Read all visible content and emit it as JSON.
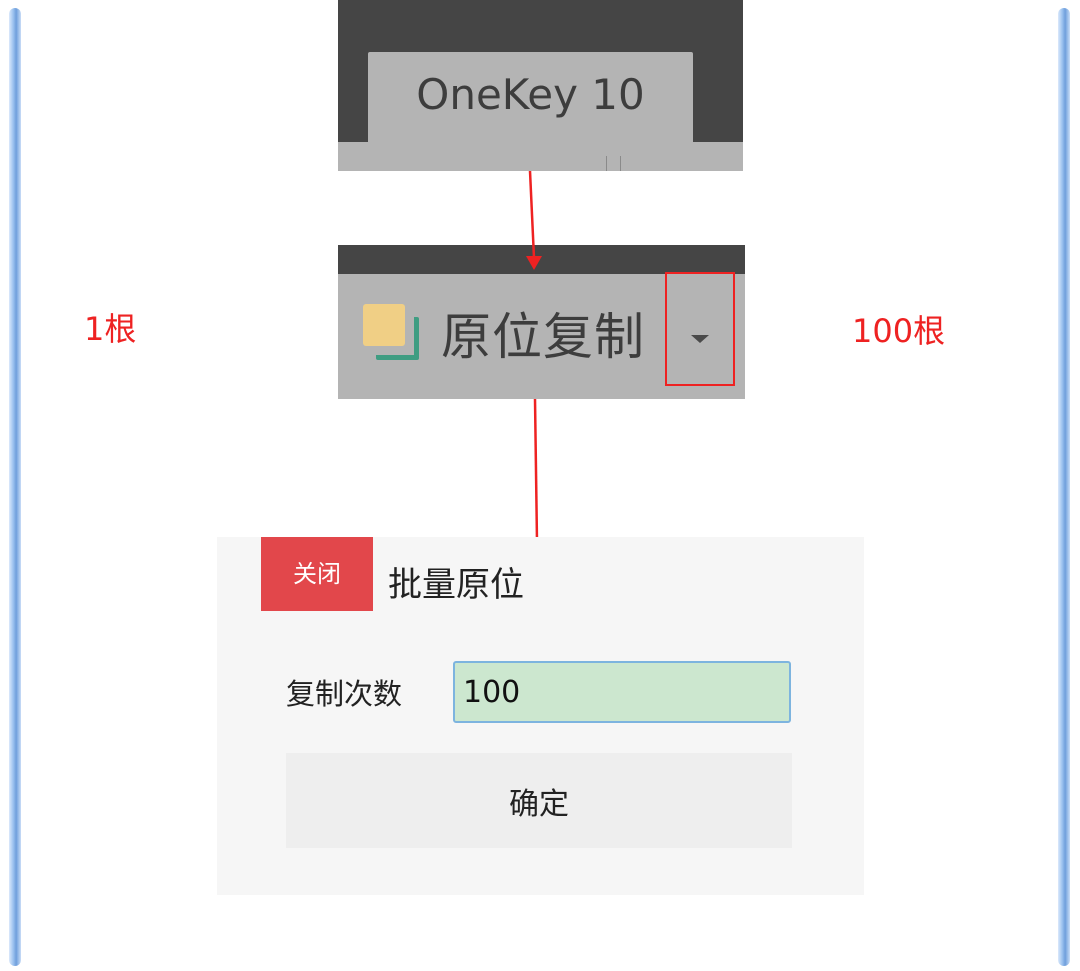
{
  "labels": {
    "left_count": "1根",
    "right_count": "100根"
  },
  "ribbon_tab": {
    "label": "OneKey 10"
  },
  "ribbon_button": {
    "label": "原位复制",
    "icon": "copy-in-place-icon",
    "dropdown_icon": "caret-down-icon"
  },
  "dialog": {
    "close_label": "关闭",
    "title": "批量原位",
    "field_label": "复制次数",
    "field_value": "100",
    "confirm_label": "确定"
  },
  "colors": {
    "highlight_red": "#ee2222",
    "close_button": "#e2474b",
    "input_fill": "#cce7cf",
    "ribbon_dark": "#454545",
    "ribbon_gray": "#b4b4b4",
    "rod_blue": "#9cc2ef"
  }
}
